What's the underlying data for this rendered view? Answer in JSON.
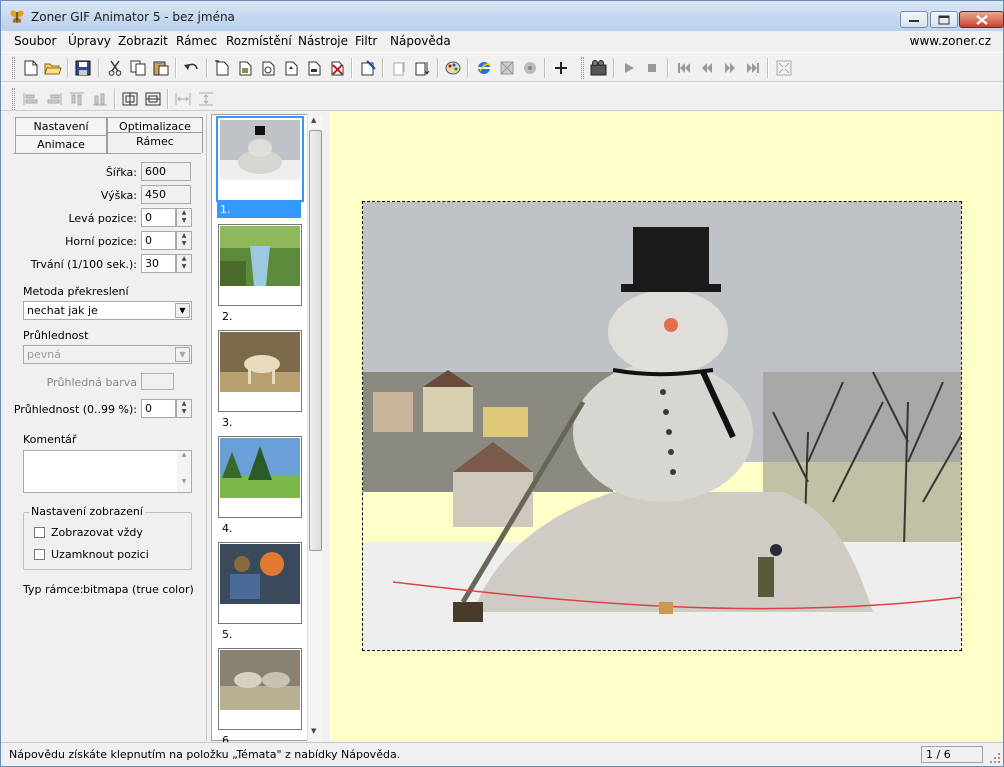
{
  "window": {
    "title": "Zoner GIF Animator 5 - bez jména",
    "minimize": "minimize",
    "maximize": "maximize",
    "close": "close"
  },
  "menu": {
    "items": [
      "Soubor",
      "Úpravy",
      "Zobrazit",
      "Rámec",
      "Rozmístění",
      "Nástroje",
      "Filtr",
      "Nápověda"
    ],
    "website": "www.zoner.cz"
  },
  "tabs": {
    "nastaveni": "Nastavení",
    "optimalizace": "Optimalizace",
    "animace": "Animace",
    "ramec": "Rámec"
  },
  "frame_props": {
    "sirka_label": "Šířka:",
    "sirka_value": "600",
    "vyska_label": "Výška:",
    "vyska_value": "450",
    "leva_label": "Levá pozice:",
    "leva_value": "0",
    "horni_label": "Horní pozice:",
    "horni_value": "0",
    "trvani_label": "Trvání (1/100 sek.):",
    "trvani_value": "30",
    "metoda_label": "Metoda překreslení",
    "metoda_value": "nechat jak je",
    "pruhlednost_label": "Průhlednost",
    "pruhlednost_value": "pevná",
    "pruhledna_barva_label": "Průhledná barva",
    "pruhlednost_pct_label": "Průhlednost (0..99 %):",
    "pruhlednost_pct_value": "0",
    "komentar_label": "Komentář",
    "komentar_value": "",
    "nastaveni_zobrazeni": "Nastavení zobrazení",
    "zobrazovat_vzdy": "Zobrazovat vždy",
    "uzamknout_pozici": "Uzamknout pozici",
    "typ_ramce_label": "Typ rámce:",
    "typ_ramce_value": "bitmapa (true color)"
  },
  "frames": [
    {
      "label": "1.",
      "selected": true
    },
    {
      "label": "2.",
      "selected": false
    },
    {
      "label": "3.",
      "selected": false
    },
    {
      "label": "4.",
      "selected": false
    },
    {
      "label": "5.",
      "selected": false
    },
    {
      "label": "6.",
      "selected": false
    }
  ],
  "status": {
    "message": "Nápovědu získáte klepnutím na položku „Témata\" z nabídky Nápověda.",
    "frame_counter": "1 / 6"
  },
  "colors": {
    "canvas_bg": "#ffffc8",
    "selection": "#3399ff"
  }
}
